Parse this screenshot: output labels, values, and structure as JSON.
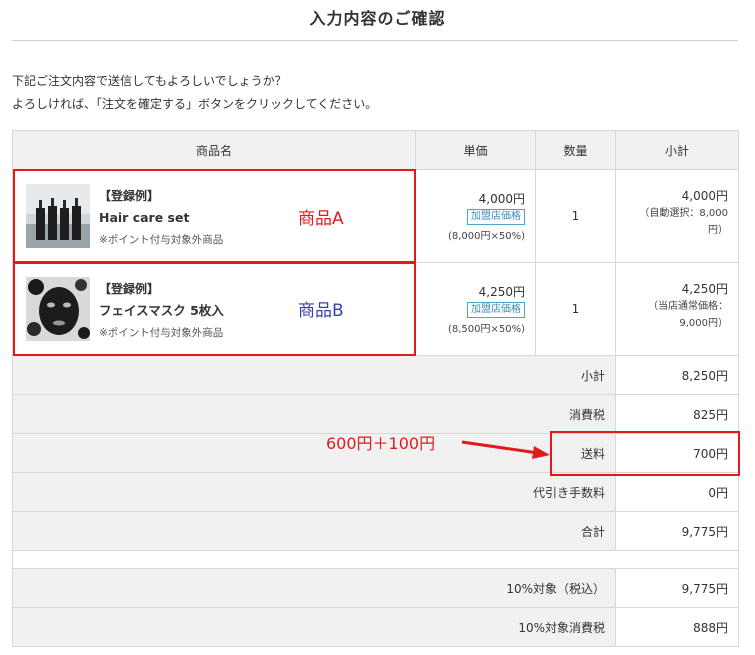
{
  "page_title": "入力内容のご確認",
  "message_line1": "下記ご注文内容で送信してもよろしいでしょうか？",
  "message_line2": "よろしければ、「注文を確定する」ボタンをクリックしてください。",
  "table_headers": {
    "product": "商品名",
    "unit_price": "単価",
    "quantity": "数量",
    "subtotal": "小計"
  },
  "items": [
    {
      "badge": "【登録例】",
      "name": "Hair care set",
      "note": "※ポイント付与対象外商品",
      "price": "4,000円",
      "price_tag": "加盟店価格",
      "price_calc": "(8,000円×50%)",
      "quantity": "1",
      "subtotal": "4,000円",
      "subtotal_note_1": "（自動選択：8,000",
      "subtotal_note_2": "円）",
      "annotation": "商品A",
      "annotation_color": "#e01b1b"
    },
    {
      "badge": "【登録例】",
      "name": "フェイスマスク 5枚入",
      "note": "※ポイント付与対象外商品",
      "price": "4,250円",
      "price_tag": "加盟店価格",
      "price_calc": "(8,500円×50%)",
      "quantity": "1",
      "subtotal": "4,250円",
      "subtotal_note_1": "（当店通常価格：",
      "subtotal_note_2": "9,000円）",
      "annotation": "商品B",
      "annotation_color": "#3a3fb5"
    }
  ],
  "summary": [
    {
      "label": "小計",
      "value": "8,250円"
    },
    {
      "label": "消費税",
      "value": "825円"
    },
    {
      "label": "送料",
      "value": "700円"
    },
    {
      "label": "代引き手数料",
      "value": "0円"
    },
    {
      "label": "合計",
      "value": "9,775円"
    }
  ],
  "tax_summary": [
    {
      "label": "10%対象（税込）",
      "value": "9,775円"
    },
    {
      "label": "10%対象消費税",
      "value": "888円"
    }
  ],
  "shipping_annotation": "600円＋100円",
  "colors": {
    "annotation_red": "#e01b1b",
    "annotation_blue": "#3a3fb5",
    "header_bg": "#f1f1f1",
    "chip": "#3a8fb5"
  }
}
